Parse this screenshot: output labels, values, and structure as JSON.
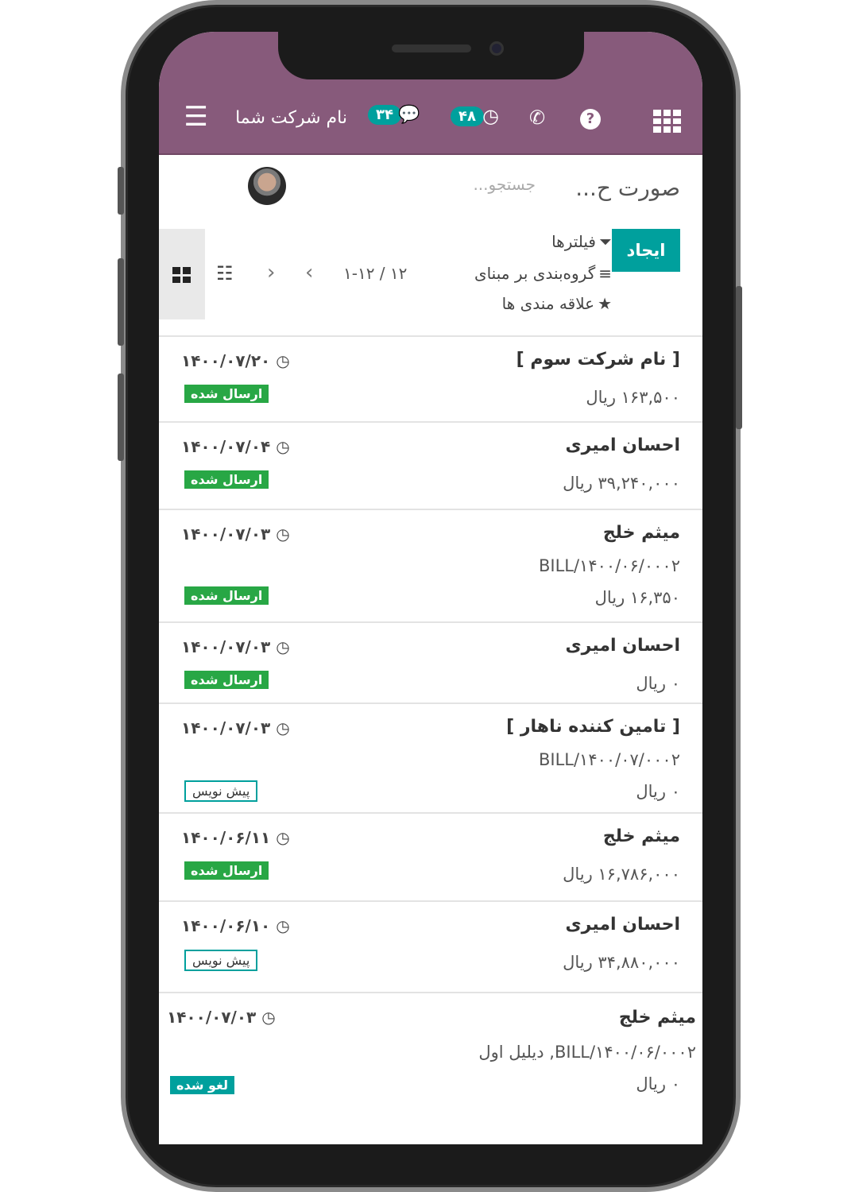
{
  "header": {
    "company": "نام شرکت شما",
    "messages_count": "۳۴",
    "activities_count": "۴۸",
    "icons": [
      "menu-icon",
      "chat-icon",
      "clock-icon",
      "phone-icon",
      "help-icon",
      "apps-grid-icon"
    ]
  },
  "control": {
    "breadcrumb": "صورت ح...",
    "search_placeholder": "جستجو...",
    "create": "ایجاد",
    "filters": "فیلترها",
    "group_by": "گروه‌بندی بر مبنای",
    "favorites": "علاقه مندی ها",
    "pager": "۱-۱۲ / ۱۲"
  },
  "colors": {
    "brand": "#875a7b",
    "accent": "#00a09d",
    "sent": "#28a745"
  },
  "rows": [
    {
      "name": "[ نام شرکت سوم ]",
      "ref": "",
      "amount": "۱۶۳,۵۰۰ ریال",
      "date": "۱۴۰۰/۰۷/۲۰",
      "status": "ارسال شده"
    },
    {
      "name": "احسان امیری",
      "ref": "",
      "amount": "۳۹,۲۴۰,۰۰۰ ریال",
      "date": "۱۴۰۰/۰۷/۰۴",
      "status": "ارسال شده"
    },
    {
      "name": "میثم خلج",
      "ref": "BILL/۱۴۰۰/۰۶/۰۰۰۲",
      "amount": "۱۶,۳۵۰ ریال",
      "date": "۱۴۰۰/۰۷/۰۳",
      "status": "ارسال شده"
    },
    {
      "name": "احسان امیری",
      "ref": "",
      "amount": "۰ ریال",
      "date": "۱۴۰۰/۰۷/۰۳",
      "status": "ارسال شده"
    },
    {
      "name": "[ تامین کننده ناهار ]",
      "ref": "BILL/۱۴۰۰/۰۷/۰۰۰۲",
      "amount": "۰ ریال",
      "date": "۱۴۰۰/۰۷/۰۳",
      "status": "پیش نویس"
    },
    {
      "name": "میثم خلج",
      "ref": "",
      "amount": "۱۶,۷۸۶,۰۰۰ ریال",
      "date": "۱۴۰۰/۰۶/۱۱",
      "status": "ارسال شده"
    },
    {
      "name": "احسان امیری",
      "ref": "",
      "amount": "۳۴,۸۸۰,۰۰۰ ریال",
      "date": "۱۴۰۰/۰۶/۱۰",
      "status": "پیش نویس"
    },
    {
      "name": "میثم خلج",
      "ref": "BILL/۱۴۰۰/۰۶/۰۰۰۲, دیلیل اول",
      "amount": "۰ ریال",
      "date": "۱۴۰۰/۰۷/۰۳",
      "status": "لغو شده"
    }
  ]
}
